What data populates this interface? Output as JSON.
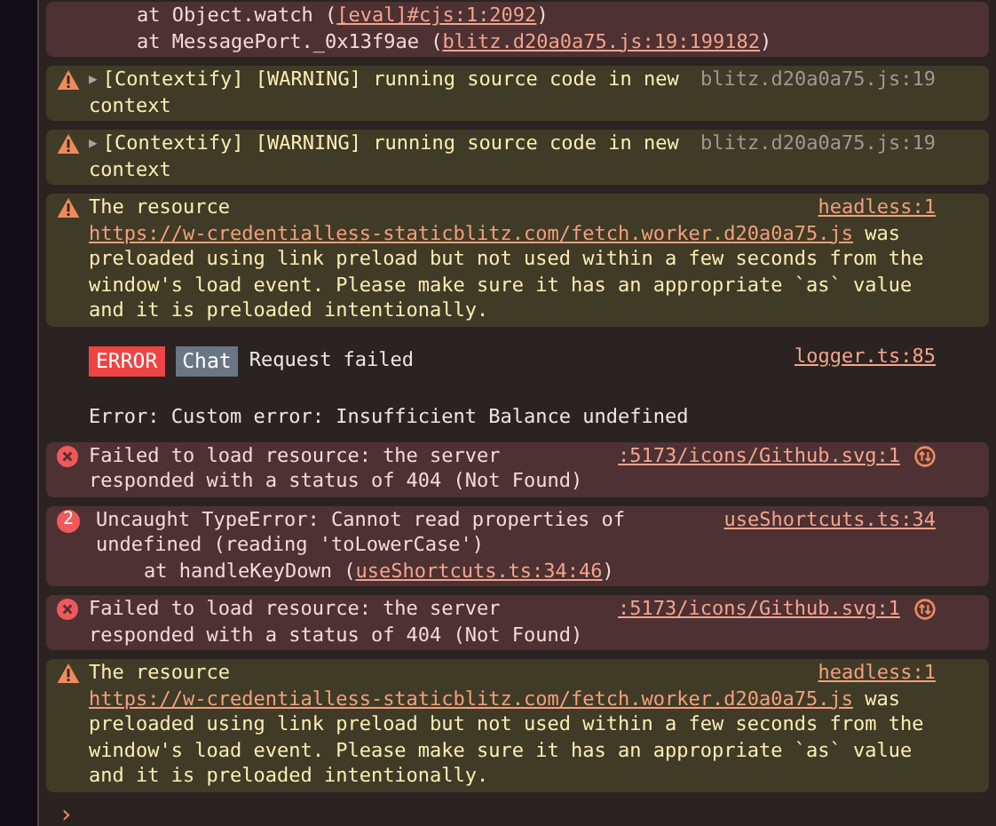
{
  "messages": [
    {
      "kind": "error_tail",
      "lines": [
        {
          "kind": "frame",
          "parts": [
            {
              "text": "at Object.watch (",
              "link": false
            },
            {
              "text": "[eval]#cjs:1:2092",
              "link": true
            },
            {
              "text": ")",
              "link": false
            }
          ]
        },
        {
          "kind": "frame",
          "parts": [
            {
              "text": "at MessagePort._0x13f9ae (",
              "link": false
            },
            {
              "text": "blitz.d20a0a75.js:19:199182",
              "link": true
            },
            {
              "text": ")",
              "link": false
            }
          ]
        }
      ]
    },
    {
      "kind": "warning",
      "toggle": {
        "glyph": "▶",
        "expanded": false
      },
      "source": {
        "text": "blitz.d20a0a75.js:19",
        "linked": false
      },
      "network_icon": false,
      "lines": [
        {
          "kind": "text",
          "parts": [
            {
              "text": "[Contextify] [WARNING] running source code in new",
              "link": false
            }
          ]
        },
        {
          "kind": "text",
          "parts": [
            {
              "text": "context",
              "link": false
            }
          ]
        }
      ]
    },
    {
      "kind": "warning",
      "toggle": {
        "glyph": "▶",
        "expanded": false
      },
      "source": {
        "text": "blitz.d20a0a75.js:19",
        "linked": false
      },
      "network_icon": false,
      "lines": [
        {
          "kind": "text",
          "parts": [
            {
              "text": "[Contextify] [WARNING] running source code in new",
              "link": false
            }
          ]
        },
        {
          "kind": "text",
          "parts": [
            {
              "text": "context",
              "link": false
            }
          ]
        }
      ]
    },
    {
      "kind": "warning",
      "source": {
        "text": "headless:1",
        "linked": true
      },
      "network_icon": false,
      "lines": [
        {
          "kind": "text",
          "parts": [
            {
              "text": "The resource",
              "link": false
            }
          ]
        },
        {
          "kind": "text",
          "parts": [
            {
              "text": "https://w-credentialless-staticblitz.com/fetch.worker.d20a0a75.js",
              "link": true
            },
            {
              "text": " was",
              "link": false
            }
          ]
        },
        {
          "kind": "text",
          "parts": [
            {
              "text": "preloaded using link preload but not used within a few seconds from the",
              "link": false
            }
          ]
        },
        {
          "kind": "text",
          "parts": [
            {
              "text": "window's load event. Please make sure it has an appropriate `as` value",
              "link": false
            }
          ]
        },
        {
          "kind": "text",
          "parts": [
            {
              "text": "and it is preloaded intentionally.",
              "link": false
            }
          ]
        }
      ]
    },
    {
      "kind": "log",
      "source": {
        "text": "logger.ts:85",
        "linked": true
      },
      "network_icon": false,
      "badges": [
        {
          "text": "ERROR",
          "color": "#ef4444"
        },
        {
          "text": "Chat",
          "color": "#6b7684"
        }
      ],
      "lines": [
        {
          "kind": "text",
          "parts": [
            {
              "text": "Request failed",
              "link": false
            }
          ]
        },
        {
          "kind": "blank"
        },
        {
          "kind": "text",
          "parts": [
            {
              "text": "Error: Custom error: Insufficient Balance undefined",
              "link": false
            }
          ]
        }
      ]
    },
    {
      "kind": "error",
      "source": {
        "text": ":5173/icons/Github.svg:1",
        "linked": true
      },
      "network_icon": true,
      "lines": [
        {
          "kind": "text",
          "parts": [
            {
              "text": "Failed to load resource: the server",
              "link": false
            }
          ]
        },
        {
          "kind": "text",
          "parts": [
            {
              "text": "responded with a status of 404 (Not Found)",
              "link": false
            }
          ]
        }
      ]
    },
    {
      "kind": "error",
      "count": "2",
      "source": {
        "text": "useShortcuts.ts:34",
        "linked": true
      },
      "network_icon": false,
      "lines": [
        {
          "kind": "text",
          "parts": [
            {
              "text": "Uncaught TypeError: Cannot read properties of",
              "link": false
            }
          ]
        },
        {
          "kind": "text",
          "parts": [
            {
              "text": "undefined (reading 'toLowerCase')",
              "link": false
            }
          ]
        },
        {
          "kind": "frame",
          "parts": [
            {
              "text": "at handleKeyDown (",
              "link": false
            },
            {
              "text": "useShortcuts.ts:34:46",
              "link": true
            },
            {
              "text": ")",
              "link": false
            }
          ]
        }
      ]
    },
    {
      "kind": "error",
      "source": {
        "text": ":5173/icons/Github.svg:1",
        "linked": true
      },
      "network_icon": true,
      "lines": [
        {
          "kind": "text",
          "parts": [
            {
              "text": "Failed to load resource: the server",
              "link": false
            }
          ]
        },
        {
          "kind": "text",
          "parts": [
            {
              "text": "responded with a status of 404 (Not Found)",
              "link": false
            }
          ]
        }
      ]
    },
    {
      "kind": "warning",
      "source": {
        "text": "headless:1",
        "linked": true
      },
      "network_icon": false,
      "lines": [
        {
          "kind": "text",
          "parts": [
            {
              "text": "The resource",
              "link": false
            }
          ]
        },
        {
          "kind": "text",
          "parts": [
            {
              "text": "https://w-credentialless-staticblitz.com/fetch.worker.d20a0a75.js",
              "link": true
            },
            {
              "text": " was",
              "link": false
            }
          ]
        },
        {
          "kind": "text",
          "parts": [
            {
              "text": "preloaded using link preload but not used within a few seconds from the",
              "link": false
            }
          ]
        },
        {
          "kind": "text",
          "parts": [
            {
              "text": "window's load event. Please make sure it has an appropriate `as` value",
              "link": false
            }
          ]
        },
        {
          "kind": "text",
          "parts": [
            {
              "text": "and it is preloaded intentionally.",
              "link": false
            }
          ]
        }
      ]
    }
  ],
  "prompt": {
    "glyph": "›"
  }
}
